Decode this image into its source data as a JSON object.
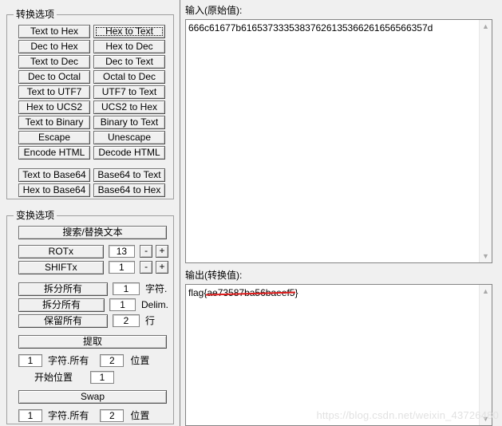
{
  "conversion_panel": {
    "title": "转换选项",
    "rows": [
      {
        "left": "Text to Hex",
        "right": "Hex to Text",
        "focused": "right"
      },
      {
        "left": "Dec to Hex",
        "right": "Hex to Dec"
      },
      {
        "left": "Text to Dec",
        "right": "Dec to Text"
      },
      {
        "left": "Dec to Octal",
        "right": "Octal to Dec"
      },
      {
        "left": "Text to UTF7",
        "right": "UTF7 to Text"
      },
      {
        "left": "Hex to UCS2",
        "right": "UCS2 to Hex"
      },
      {
        "left": "Text to Binary",
        "right": "Binary to Text"
      },
      {
        "left": "Escape",
        "right": "Unescape"
      },
      {
        "left": "Encode HTML",
        "right": "Decode HTML"
      }
    ],
    "base64_rows": [
      {
        "left": "Text to Base64",
        "right": "Base64 to Text"
      },
      {
        "left": "Hex to Base64",
        "right": "Base64 to Hex"
      }
    ]
  },
  "transform_panel": {
    "title": "变换选项",
    "search_replace_label": "搜索/替换文本",
    "rotx": {
      "label": "ROTx",
      "value": "13",
      "minus": "-",
      "plus": "+"
    },
    "shiftx": {
      "label": "SHIFTx",
      "value": "1",
      "minus": "-",
      "plus": "+"
    },
    "split_char": {
      "label": "拆分所有",
      "value": "1",
      "unit": "字符."
    },
    "split_delim": {
      "label": "拆分所有",
      "value": "1",
      "unit": "Delim."
    },
    "keep_lines": {
      "label": "保留所有",
      "value": "2",
      "unit": "行"
    },
    "extract": {
      "button": "提取",
      "count": "1",
      "count_label": "字符.所有",
      "position": "2",
      "position_label": "位置",
      "start_label": "开始位置",
      "start_value": "1"
    },
    "swap": {
      "button": "Swap",
      "count": "1",
      "count_label": "字符.所有",
      "position": "2",
      "position_label": "位置"
    }
  },
  "input_field": {
    "label": "输入(原始值):",
    "value": "666c61677b61653733353837626135366261656566357d"
  },
  "output_field": {
    "label": "输出(转换值):",
    "prefix": "flag{",
    "redacted": "ae73587ba56baeef5",
    "suffix": "}"
  },
  "watermark": {
    "text": "https://blog.csdn.net/weixin_43726480"
  },
  "icons": {
    "scroll_up": "▲",
    "scroll_down": "▼"
  }
}
